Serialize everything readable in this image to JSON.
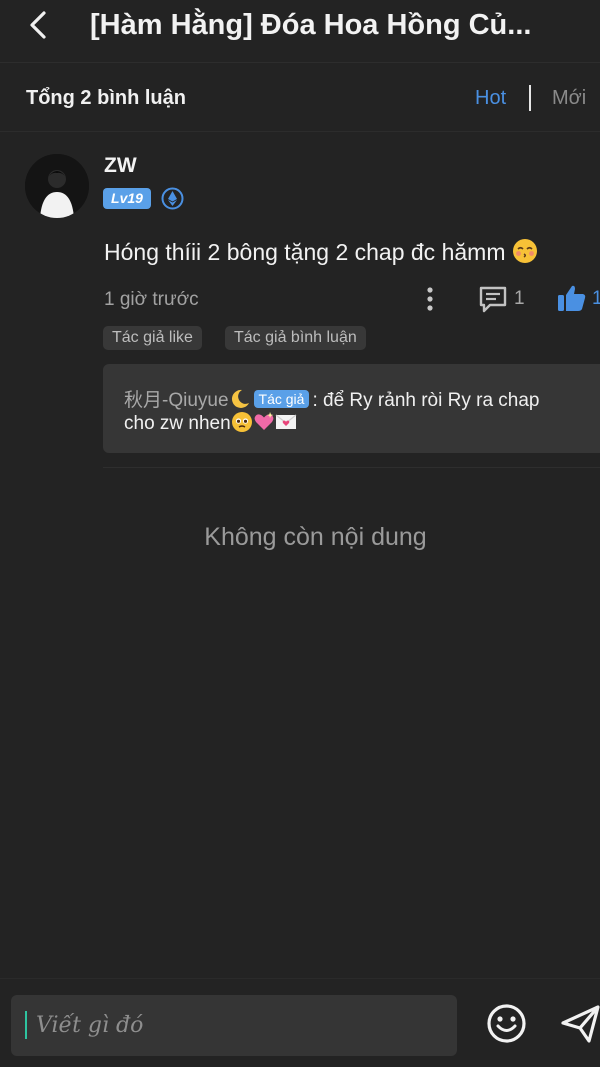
{
  "header": {
    "back_icon": "chevron-left-icon",
    "title": "[Hàm Hằng] Đóa Hoa Hồng Củ..."
  },
  "toolbar": {
    "total_label": "Tổng 2 bình luận",
    "sort_hot": "Hot",
    "sort_new": "Mới"
  },
  "comment": {
    "username": "ZW",
    "level": "Lv19",
    "text": "Hóng thíii 2 bông tặng 2 chap đc hămm",
    "time": "1 giờ trước",
    "reply_count": "1",
    "like_count": "1",
    "tags": [
      "Tác giả like",
      "Tác giả bình luận"
    ],
    "reply": {
      "name": "秋月-Qiuyue",
      "author_tag": "Tác giả",
      "text_line1": ": để Ry rảnh ròi Ry ra chap",
      "text_line2": "cho zw nhen"
    }
  },
  "empty_label": "Không còn nội dung",
  "composer": {
    "placeholder": "Viết gì đó",
    "emoji_icon": "smiley-icon",
    "send_icon": "send-icon"
  },
  "colors": {
    "accent": "#4a90e2",
    "badge": "#5aa0e8",
    "background": "#232323"
  }
}
